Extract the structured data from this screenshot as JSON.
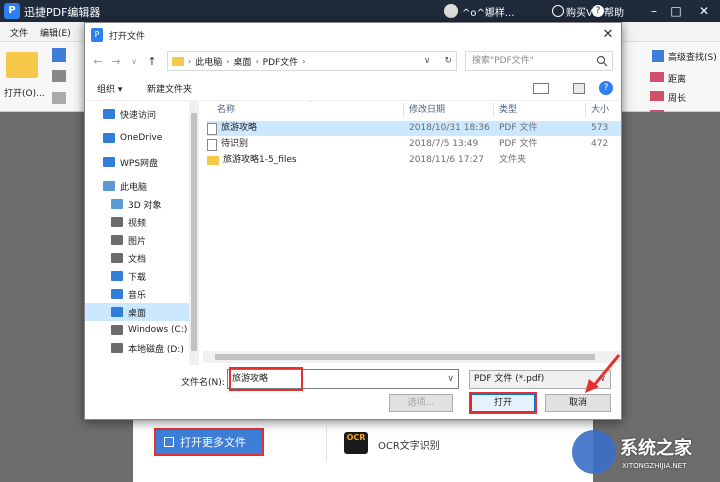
{
  "app": {
    "logo": "P",
    "name": "迅捷PDF编辑器",
    "user": "^o^娜样...",
    "vip": "购买VIP",
    "help": "帮助",
    "menu": [
      "文件",
      "编辑(E)"
    ],
    "ribbon_right": [
      "高级查找(S)",
      "距离",
      "周长",
      "面积"
    ],
    "ribbon_open": "打开(O)..."
  },
  "start": {
    "more_files": "打开更多文件",
    "ocr_icon": "OCR",
    "ocr_label": "OCR文字识别"
  },
  "watermark": {
    "text": "系统之家",
    "url": "XITONGZHIJIA.NET"
  },
  "dialog": {
    "title": "打开文件",
    "breadcrumb": [
      "此电脑",
      "桌面",
      "PDF文件"
    ],
    "search_placeholder": "搜索\"PDF文件\"",
    "organize": "组织 ▾",
    "new_folder": "新建文件夹",
    "nav": [
      {
        "label": "快速访问",
        "color": "#2f7fd8"
      },
      {
        "label": "OneDrive",
        "color": "#2f7fd8"
      },
      {
        "label": "WPS网盘",
        "color": "#2f7fd8"
      },
      {
        "label": "此电脑",
        "color": "#5b9bd5"
      },
      {
        "label": "3D 对象",
        "color": "#5b9bd5"
      },
      {
        "label": "视频",
        "color": "#6b6b6b"
      },
      {
        "label": "图片",
        "color": "#6b6b6b"
      },
      {
        "label": "文档",
        "color": "#6b6b6b"
      },
      {
        "label": "下载",
        "color": "#2f7fd8"
      },
      {
        "label": "音乐",
        "color": "#2f7fd8"
      },
      {
        "label": "桌面",
        "color": "#2f7fd8"
      },
      {
        "label": "Windows (C:)",
        "color": "#6b6b6b"
      },
      {
        "label": "本地磁盘 (D:)",
        "color": "#6b6b6b"
      }
    ],
    "columns": [
      "名称",
      "修改日期",
      "类型",
      "大小"
    ],
    "files": [
      {
        "name": "旅游攻略",
        "date": "2018/10/31 18:36",
        "type": "PDF 文件",
        "size": "573",
        "icon": "pdf"
      },
      {
        "name": "待识别",
        "date": "2018/7/5 13:49",
        "type": "PDF 文件",
        "size": "472",
        "icon": "pdf"
      },
      {
        "name": "旅游攻略1-5_files",
        "date": "2018/11/6 17:27",
        "type": "文件夹",
        "size": "",
        "icon": "folder"
      }
    ],
    "filename_label": "文件名(N):",
    "filename_value": "旅游攻略",
    "filetype": "PDF 文件 (*.pdf)",
    "btn_options": "选项...",
    "btn_open": "打开",
    "btn_cancel": "取消"
  }
}
